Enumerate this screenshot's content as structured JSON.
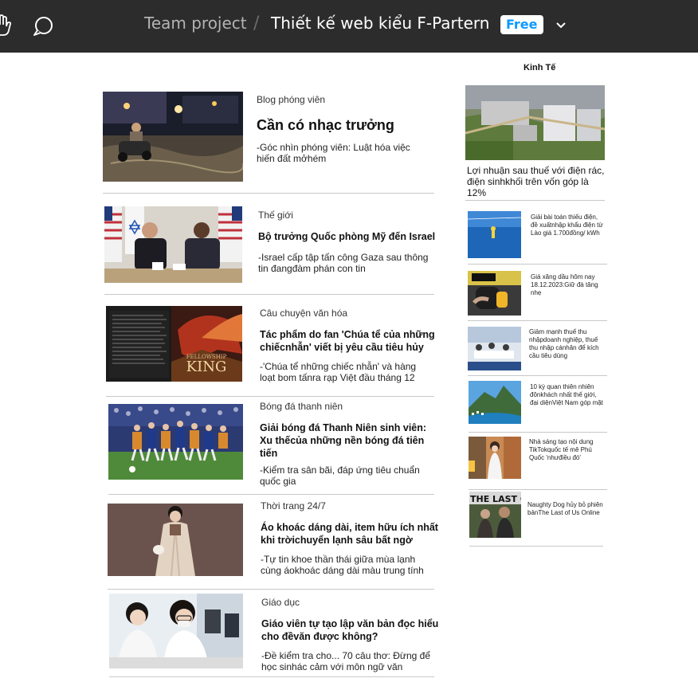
{
  "toolbar": {
    "project": "Team project",
    "separator": "/",
    "file_name": "Thiết kế web kiểu F-Partern",
    "plan_badge": "Free"
  },
  "articles": [
    {
      "category": "Blog phóng viên",
      "headline": "Cần có nhạc trưởng",
      "summary": "-Góc nhìn phóng viên: Luật hóa việc hiến đất mởhém"
    },
    {
      "category": "Thế giới",
      "headline": "Bộ trưởng Quốc phòng Mỹ đến Israel",
      "summary": "-Israel cấp tập tấn công Gaza sau thông tin đangđàm phán con tin"
    },
    {
      "category": "Câu chuyện văn hóa",
      "headline": "Tác phẩm do fan 'Chúa tể của những chiếcnhẫn' viết bị yêu cầu tiêu hủy",
      "summary": "-'Chúa tể những chiếc nhẫn' và hàng loạt bom tấnra rạp Việt đầu tháng 12"
    },
    {
      "category": "Bóng đá thanh niên",
      "headline": "Giải bóng đá Thanh Niên sinh viên: Xu thếcủa những nền bóng đá tiên tiến",
      "summary": "-Kiểm tra sân bãi, đáp ứng tiêu chuẩn quốc gia"
    },
    {
      "category": "Thời trang 24/7",
      "headline": "Áo khoác dáng dài, item hữu ích nhất khi trờichuyển lạnh sâu bất ngờ",
      "summary": "-Tự tin khoe thần thái giữa mùa lạnh cùng áokhoác dáng dài màu trung tính"
    },
    {
      "category": "Giáo dục",
      "headline": "Giáo viên tự tạo lập văn bản đọc hiểu cho đềvăn được không?",
      "summary": "-Đề kiểm tra cho... 70 câu thơ: Đừng để học sinhác cảm với môn ngữ văn"
    }
  ],
  "sidebar": {
    "title": "Kinh Tế",
    "lead": "Lợi nhuận sau thuế với điện rác, điện sinhkhối trên vốn góp là 12%",
    "items": [
      {
        "text": "Giải bài toán thiếu điện, đề xuấtnhập khẩu điện từ Lào giá 1.700đồng/ kWh"
      },
      {
        "text": "Giá xăng dầu hôm nay 18.12.2023:Giữ đà tăng nhẹ"
      },
      {
        "text": "Giảm mạnh thuế thu nhậpdoanh nghiệp, thuế thu nhập cánhân để kích cầu tiêu dùng"
      },
      {
        "text": "10 kỳ quan thiên nhiên đônkhách nhất thế giới, đại diệnViệt Nam góp mặt"
      },
      {
        "text": "Nhà sáng tạo nội dung TikTokquốc tế mê Phú Quốc 'nhưđiều đó'"
      },
      {
        "text": "Naughty Dog hủy bỏ phiên bảnThe Last of Us Online"
      }
    ],
    "last_of_us_thumb_text": "THE LAST OF U"
  },
  "book_cover": {
    "title": "KING",
    "subtitle": "FELLOWSHIP"
  }
}
